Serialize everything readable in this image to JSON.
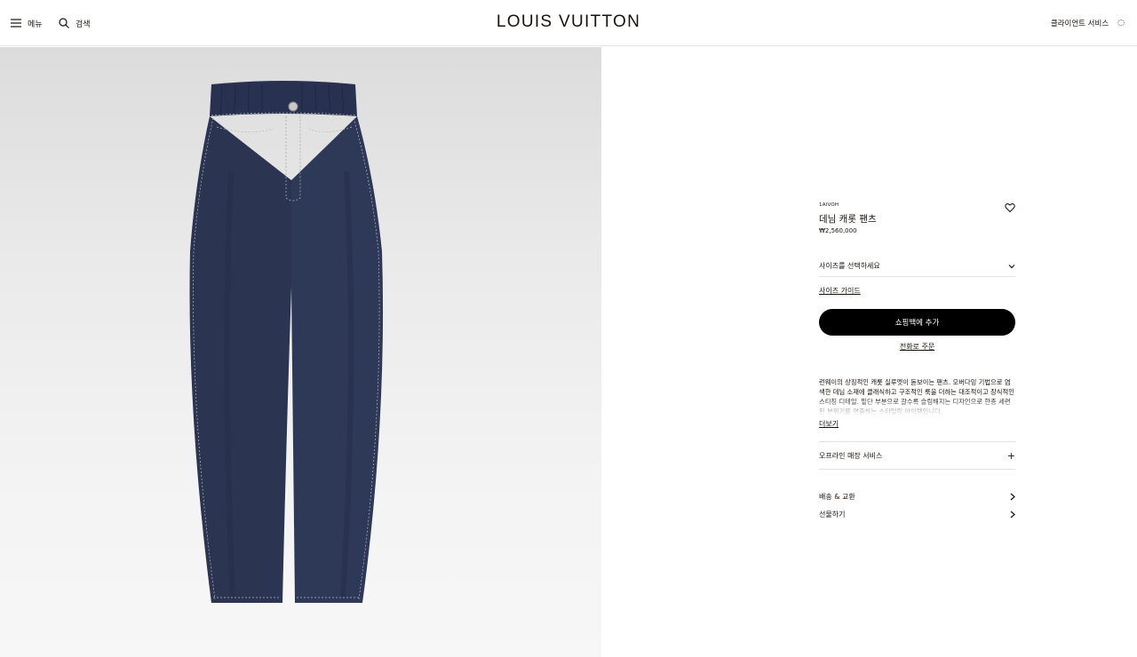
{
  "header": {
    "menu_label": "메뉴",
    "search_label": "검색",
    "logo": "LOUIS VUITTON",
    "client_service": "클라이언트 서비스"
  },
  "product": {
    "sku": "1AIVOH",
    "title": "데님 캐롯 팬츠",
    "price": "₩2,560,000",
    "size_select": "사이즈를 선택하세요",
    "size_guide": "사이즈 가이드",
    "add_to_bag": "쇼핑백에 추가",
    "phone_order": "전화로 주문",
    "description": "런웨이의 상징적인 캐롯 실루엣이 돋보이는 팬츠. 오버다잉 기법으로 염색한 데님 소재에 클래식하고 구조적인 룩을 더하는 대조적이고 장식적인 스티칭 디테일. 밑단 부분으로 갈수록 슬림해지는 디자인으로 한층 세련된 분위기를 연출하는 스타일링 아이템입니다.",
    "more": "더보기",
    "offline_service": "오프라인 매장 서비스",
    "shipping": "배송 & 교환",
    "gift": "선물하기"
  },
  "icons": {
    "menu": "hamburger-icon",
    "search": "search-icon",
    "wishlist": "heart-icon",
    "size_dropdown": "chevron-down-icon",
    "expand": "plus-icon",
    "arrow": "chevron-right-icon"
  },
  "colors": {
    "text": "#19110b",
    "button_bg": "#000000",
    "denim": "#2b3552"
  }
}
